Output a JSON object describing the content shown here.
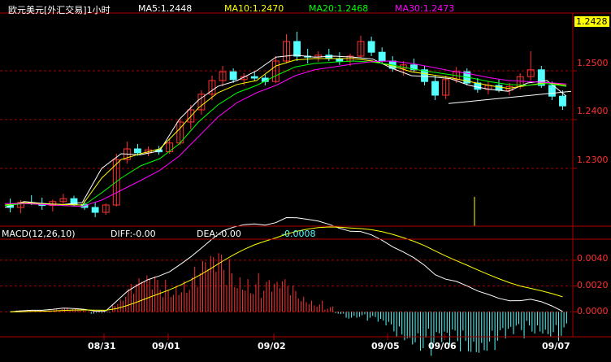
{
  "header": {
    "symbol_title": "欧元美元[外汇交易]1小时",
    "ma5": "MA5:1.2448",
    "ma10": "MA10:1.2470",
    "ma20": "MA20:1.2468",
    "ma30": "MA30:1.2473"
  },
  "price_axis": {
    "current_price": "1.2428",
    "ticks": [
      "1.2500",
      "1.2400",
      "1.2300"
    ]
  },
  "macd_header": {
    "name": "MACD(12,26,10)",
    "diff": "DIFF:-0.00",
    "dea": "DEA:-0.00",
    "macd": "-0.0008"
  },
  "macd_axis": {
    "ticks": [
      "0.0040",
      "0.0020",
      "0.0000"
    ]
  },
  "date_labels": [
    "08/31",
    "09/01",
    "09/02",
    "09/05",
    "09/06",
    "09/07"
  ],
  "colors": {
    "background": "#000000",
    "up": "#ff3232",
    "down": "#54ffff",
    "ma5": "#ffffff",
    "ma10": "#ffff00",
    "ma20": "#00ff00",
    "ma30": "#ff00ff",
    "grid": "#b00000"
  },
  "chart_data": {
    "type": "line",
    "title": "欧元美元[外汇交易]1小时",
    "series": [
      {
        "name": "MA5",
        "values": [
          1.222,
          1.2232,
          1.2228,
          1.2226,
          1.223,
          1.23,
          1.233,
          1.2328,
          1.2336,
          1.24,
          1.244,
          1.2468,
          1.248,
          1.25,
          1.2528,
          1.2532,
          1.2528,
          1.253,
          1.2528,
          1.2524,
          1.2505,
          1.249,
          1.2488,
          1.2484,
          1.247,
          1.2462,
          1.2458,
          1.2475,
          1.248,
          1.2448
        ]
      },
      {
        "name": "MA10",
        "values": [
          1.2225,
          1.223,
          1.2227,
          1.2226,
          1.2225,
          1.228,
          1.2318,
          1.233,
          1.234,
          1.238,
          1.2424,
          1.2455,
          1.2472,
          1.248,
          1.251,
          1.2522,
          1.2525,
          1.2525,
          1.2525,
          1.252,
          1.251,
          1.2498,
          1.2492,
          1.2486,
          1.2478,
          1.247,
          1.2464,
          1.247,
          1.2476,
          1.247
        ]
      },
      {
        "name": "MA20",
        "values": [
          1.2224,
          1.2228,
          1.2226,
          1.2224,
          1.2222,
          1.225,
          1.228,
          1.2305,
          1.232,
          1.235,
          1.2395,
          1.243,
          1.2455,
          1.247,
          1.249,
          1.2508,
          1.2515,
          1.2518,
          1.252,
          1.2518,
          1.2512,
          1.2504,
          1.2498,
          1.2492,
          1.2486,
          1.2478,
          1.2472,
          1.247,
          1.2474,
          1.2468
        ]
      },
      {
        "name": "MA30",
        "values": [
          1.2228,
          1.2228,
          1.2226,
          1.2224,
          1.2222,
          1.2235,
          1.2255,
          1.2275,
          1.2296,
          1.2325,
          1.2365,
          1.2405,
          1.2435,
          1.2455,
          1.247,
          1.249,
          1.2502,
          1.2508,
          1.2514,
          1.2519,
          1.252,
          1.2515,
          1.2508,
          1.25,
          1.2494,
          1.2486,
          1.248,
          1.2478,
          1.2476,
          1.2473
        ]
      }
    ],
    "candles": [
      [
        1.2225,
        1.2238,
        1.221,
        1.222
      ],
      [
        1.222,
        1.2235,
        1.2208,
        1.223
      ],
      [
        1.223,
        1.2245,
        1.2225,
        1.2228
      ],
      [
        1.2228,
        1.224,
        1.2215,
        1.2224
      ],
      [
        1.2224,
        1.2236,
        1.2212,
        1.2232
      ],
      [
        1.2232,
        1.2248,
        1.2228,
        1.2238
      ],
      [
        1.2238,
        1.2244,
        1.2222,
        1.2226
      ],
      [
        1.2226,
        1.2234,
        1.2215,
        1.222
      ],
      [
        1.222,
        1.223,
        1.22,
        1.221
      ],
      [
        1.221,
        1.2228,
        1.2205,
        1.2225
      ],
      [
        1.2225,
        1.233,
        1.2222,
        1.2318
      ],
      [
        1.2318,
        1.2355,
        1.231,
        1.234
      ],
      [
        1.234,
        1.235,
        1.2326,
        1.2332
      ],
      [
        1.2332,
        1.2345,
        1.2325,
        1.2338
      ],
      [
        1.2338,
        1.2346,
        1.2328,
        1.2334
      ],
      [
        1.2334,
        1.236,
        1.233,
        1.2352
      ],
      [
        1.2352,
        1.24,
        1.2348,
        1.2395
      ],
      [
        1.2395,
        1.243,
        1.238,
        1.242
      ],
      [
        1.242,
        1.246,
        1.241,
        1.2452
      ],
      [
        1.2452,
        1.249,
        1.244,
        1.248
      ],
      [
        1.248,
        1.251,
        1.2468,
        1.2498
      ],
      [
        1.2498,
        1.2505,
        1.2475,
        1.2482
      ],
      [
        1.2482,
        1.2495,
        1.247,
        1.2488
      ],
      [
        1.2488,
        1.2498,
        1.248,
        1.2485
      ],
      [
        1.2485,
        1.2492,
        1.247,
        1.2478
      ],
      [
        1.2478,
        1.253,
        1.2475,
        1.252
      ],
      [
        1.252,
        1.2575,
        1.2515,
        1.256
      ],
      [
        1.256,
        1.258,
        1.252,
        1.253
      ],
      [
        1.253,
        1.2545,
        1.2515,
        1.2528
      ],
      [
        1.2528,
        1.254,
        1.2518,
        1.2532
      ],
      [
        1.2532,
        1.2545,
        1.252,
        1.2525
      ],
      [
        1.2525,
        1.2538,
        1.2512,
        1.252
      ],
      [
        1.252,
        1.2535,
        1.251,
        1.253
      ],
      [
        1.253,
        1.2572,
        1.2526,
        1.256
      ],
      [
        1.256,
        1.257,
        1.253,
        1.2538
      ],
      [
        1.2538,
        1.2548,
        1.2515,
        1.252
      ],
      [
        1.252,
        1.253,
        1.2498,
        1.2505
      ],
      [
        1.2505,
        1.252,
        1.249,
        1.2512
      ],
      [
        1.2512,
        1.2525,
        1.2498,
        1.2502
      ],
      [
        1.2502,
        1.251,
        1.247,
        1.2478
      ],
      [
        1.2478,
        1.249,
        1.244,
        1.245
      ],
      [
        1.245,
        1.249,
        1.2442,
        1.2482
      ],
      [
        1.2482,
        1.2508,
        1.2475,
        1.2498
      ],
      [
        1.2498,
        1.2505,
        1.247,
        1.2475
      ],
      [
        1.2475,
        1.2485,
        1.2455,
        1.2462
      ],
      [
        1.2462,
        1.2478,
        1.2452,
        1.247
      ],
      [
        1.247,
        1.2482,
        1.2456,
        1.246
      ],
      [
        1.246,
        1.2475,
        1.245,
        1.2468
      ],
      [
        1.2468,
        1.2495,
        1.2462,
        1.2488
      ],
      [
        1.2488,
        1.254,
        1.248,
        1.2502
      ],
      [
        1.2502,
        1.251,
        1.2465,
        1.247
      ],
      [
        1.247,
        1.2478,
        1.244,
        1.2448
      ],
      [
        1.2448,
        1.246,
        1.242,
        1.2428
      ]
    ]
  }
}
